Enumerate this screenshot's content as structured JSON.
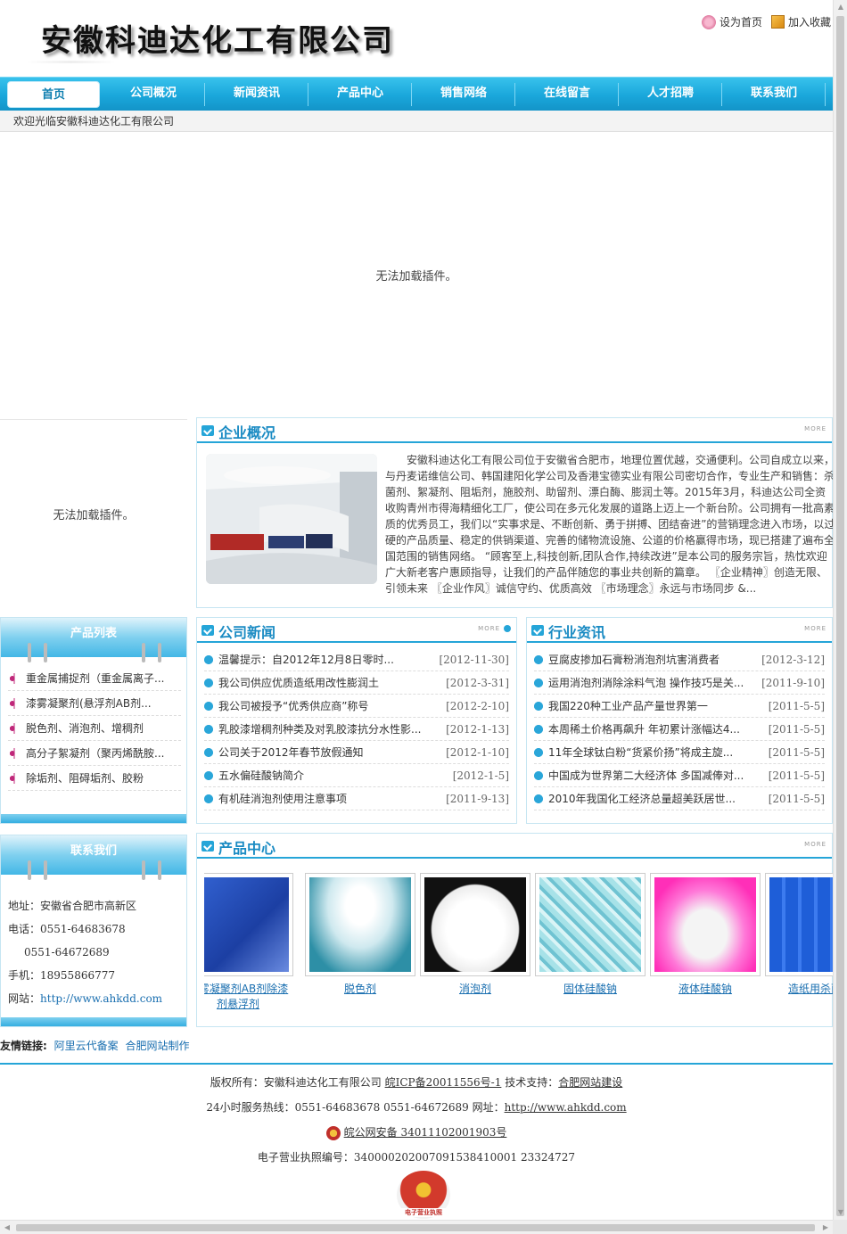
{
  "header": {
    "company_name": "安徽科迪达化工有限公司",
    "set_home": "设为首页",
    "add_favorite": "加入收藏"
  },
  "nav": [
    "首页",
    "公司概况",
    "新闻资讯",
    "产品中心",
    "销售网络",
    "在线留言",
    "人才招聘",
    "联系我们"
  ],
  "welcome": "欢迎光临安徽科迪达化工有限公司",
  "plugin_error": "无法加载插件。",
  "intro": {
    "title": "企业概况",
    "more": "MORE",
    "text": "安徽科迪达化工有限公司位于安徽省合肥市，地理位置优越，交通便利。公司自成立以来，与丹麦诺维信公司、韩国建阳化学公司及香港宝德实业有限公司密切合作，专业生产和销售：杀菌剂、絮凝剂、阻垢剂，施胶剂、助留剂、漂白酶、膨润土等。2015年3月，科迪达公司全资收购青州市得海精细化工厂，使公司在多元化发展的道路上迈上一个新台阶。公司拥有一批高素质的优秀员工，我们以“实事求是、不断创新、勇于拼搏、团结奋进”的营销理念进入市场，以过硬的产品质量、稳定的供销渠道、完善的储物流设施、公道的价格赢得市场，现已搭建了遍布全国范围的销售网络。 “顾客至上,科技创新,团队合作,持续改进”是本公司的服务宗旨，热忱欢迎广大新老客户惠顾指导，让我们的产品伴随您的事业共创新的篇章。 〖企业精神〗创造无限、引领未来 〖企业作风〗诚信守约、优质高效 〖市场理念〗永远与市场同步 &..."
  },
  "products_sidebar": {
    "title": "产品列表",
    "items": [
      "重金属捕捉剂（重金属离子...",
      "漆雾凝聚剂(悬浮剂AB剂...",
      "脱色剂、消泡剂、增稠剂",
      "高分子絮凝剂（聚丙烯酰胺...",
      "除垢剂、阻碍垢剂、胶粉"
    ]
  },
  "contact": {
    "title": "联系我们",
    "address_label": "地址：",
    "address": "安徽省合肥市高新区",
    "phone_label": "电话：",
    "phone1": "0551-64683678",
    "phone2": "0551-64672689",
    "mobile_label": "手机：",
    "mobile": "18955866777",
    "site_label": "网站：",
    "site": "http://www.ahkdd.com"
  },
  "company_news": {
    "title": "公司新闻",
    "more": "MORE",
    "items": [
      {
        "title": "温馨提示：自2012年12月8日零时...",
        "date": "[2012-11-30]"
      },
      {
        "title": "我公司供应优质造纸用改性膨润土",
        "date": "[2012-3-31]"
      },
      {
        "title": "我公司被授予“优秀供应商”称号",
        "date": "[2012-2-10]"
      },
      {
        "title": "乳胶漆增稠剂种类及对乳胶漆抗分水性影...",
        "date": "[2012-1-13]"
      },
      {
        "title": "公司关于2012年春节放假通知",
        "date": "[2012-1-10]"
      },
      {
        "title": "五水偏硅酸钠简介",
        "date": "[2012-1-5]"
      },
      {
        "title": "有机硅消泡剂使用注意事项",
        "date": "[2011-9-13]"
      }
    ]
  },
  "industry_news": {
    "title": "行业资讯",
    "more": "MORE",
    "items": [
      {
        "title": "豆腐皮掺加石膏粉消泡剂坑害消费者",
        "date": "[2012-3-12]"
      },
      {
        "title": "运用消泡剂消除涂料气泡 操作技巧是关...",
        "date": "[2011-9-10]"
      },
      {
        "title": "我国220种工业产品产量世界第一",
        "date": "[2011-5-5]"
      },
      {
        "title": "本周稀土价格再飙升 年初累计涨幅达4...",
        "date": "[2011-5-5]"
      },
      {
        "title": "11年全球钛白粉“货紧价扬”将成主旋...",
        "date": "[2011-5-5]"
      },
      {
        "title": "中国成为世界第二大经济体 多国减俸对...",
        "date": "[2011-5-5]"
      },
      {
        "title": "2010年我国化工经济总量超美跃居世...",
        "date": "[2011-5-5]"
      }
    ]
  },
  "product_center": {
    "title": "产品中心",
    "more": "MORE",
    "items": [
      {
        "name": "漆雾凝聚剂AB剂除漆剂悬浮剂",
        "colors": [
          "#2b56c9",
          "#6a8be0"
        ]
      },
      {
        "name": "脱色剂",
        "colors": [
          "#d6eef3",
          "#2d8fa6"
        ]
      },
      {
        "name": "消泡剂",
        "colors": [
          "#ffffff",
          "#e8e8e8"
        ]
      },
      {
        "name": "固体硅酸钠",
        "colors": [
          "#a7e2e8",
          "#4fb1c5"
        ]
      },
      {
        "name": "液体硅酸钠",
        "colors": [
          "#ff3cc8",
          "#ffd04a"
        ]
      },
      {
        "name": "造纸用杀菌剂",
        "colors": [
          "#1e5ed8",
          "#6a95f0"
        ]
      }
    ]
  },
  "friend_links": {
    "label": "友情链接:",
    "links": [
      "阿里云代备案",
      "合肥网站制作"
    ]
  },
  "footer": {
    "copyright": "版权所有：安徽科迪达化工有限公司",
    "icp": "皖ICP备20011556号-1",
    "support_label": "技术支持：",
    "support": "合肥网站建设",
    "hotline": "24小时服务热线：0551-64683678 0551-64672689 网址：",
    "site": "http://www.ahkdd.com",
    "police": "皖公网安备 34011102001903号",
    "license": "电子营业执照编号：340000202007091538410001 23324727",
    "license_badge": "电子营业执照"
  }
}
